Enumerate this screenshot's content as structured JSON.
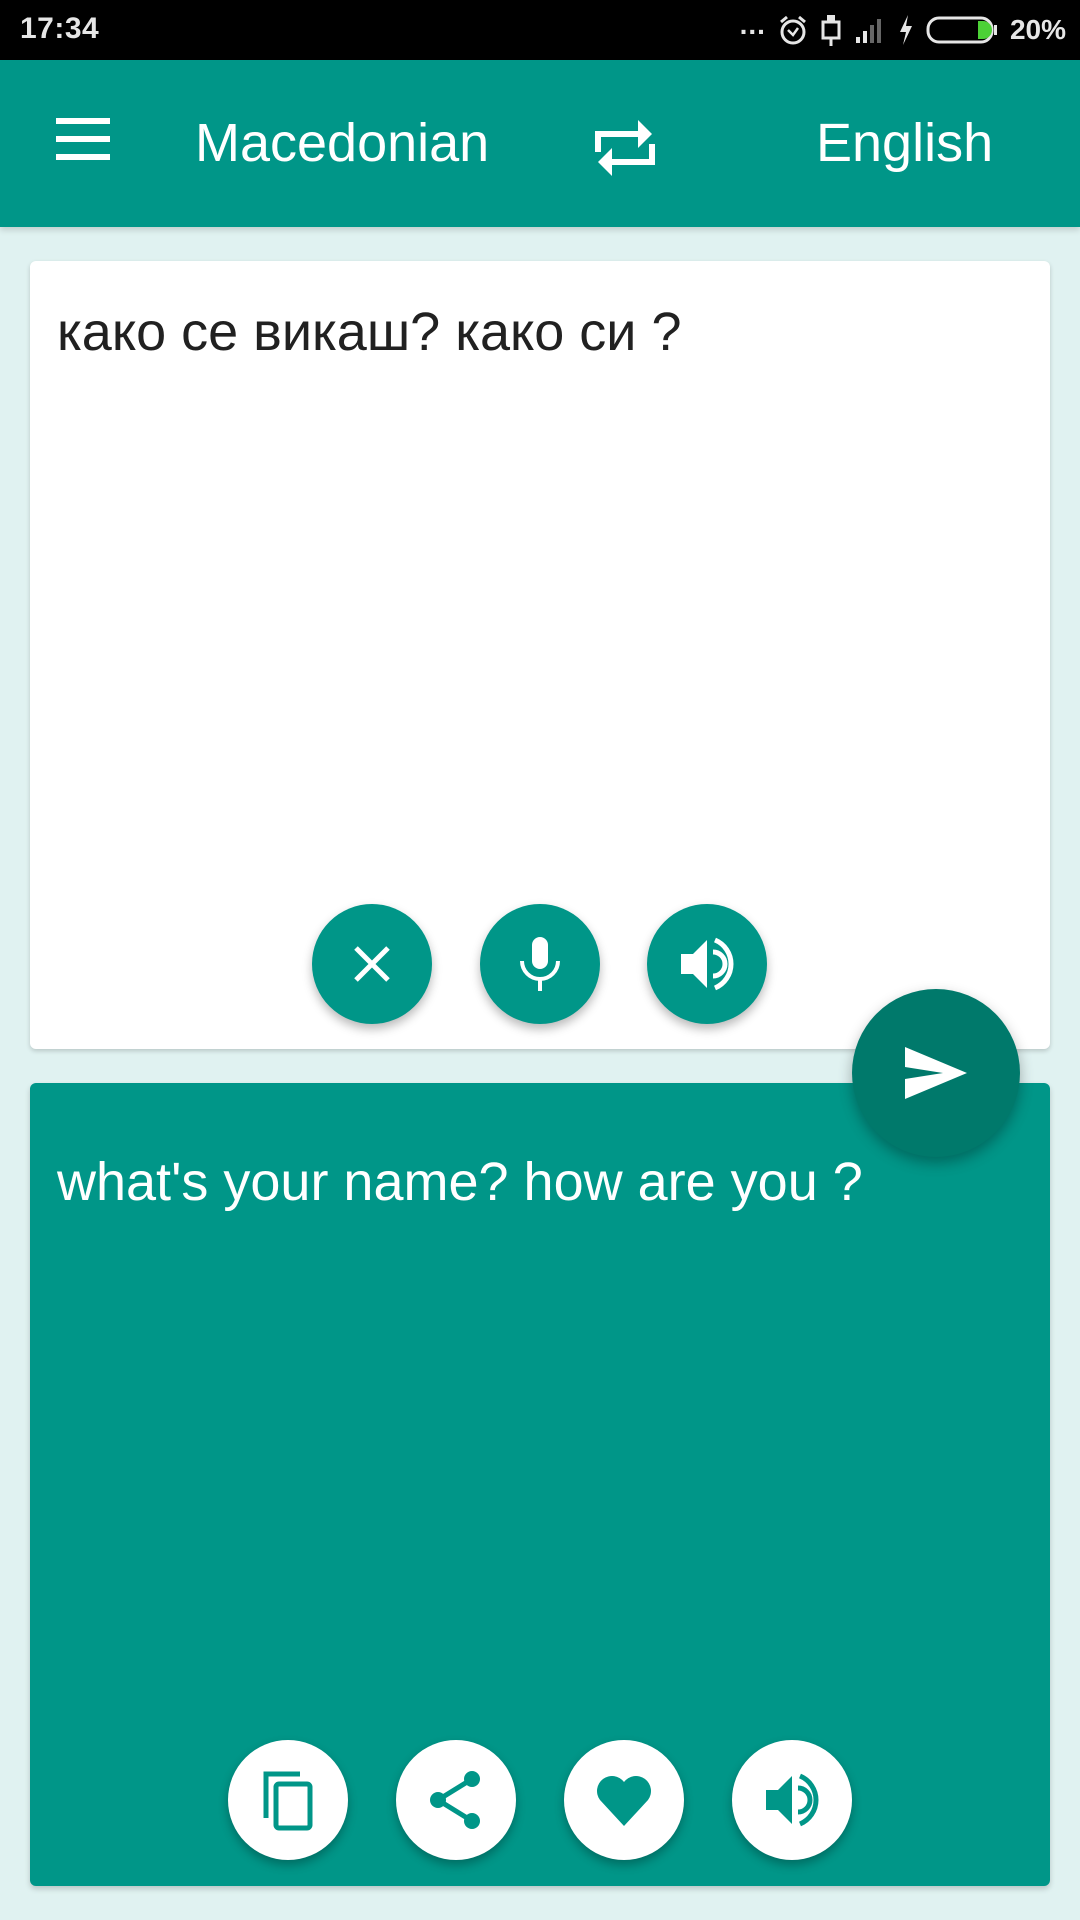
{
  "status_bar": {
    "time": "17:34",
    "more_indicator": "...",
    "icons": [
      "alarm-icon",
      "usb-icon",
      "signal-icon",
      "charging-icon",
      "battery-icon"
    ],
    "battery_percent": "20%",
    "battery_level": 0.2,
    "battery_color": "#4cd137"
  },
  "app_bar": {
    "menu_icon": "hamburger-menu-icon",
    "source_language": "Macedonian",
    "swap_icon": "swap-languages-icon",
    "target_language": "English",
    "color": "#009688"
  },
  "input_card": {
    "text": "како се викаш? како си ?",
    "buttons": [
      {
        "name": "clear",
        "icon": "close-icon"
      },
      {
        "name": "voice-input",
        "icon": "microphone-icon"
      },
      {
        "name": "speak-source",
        "icon": "speaker-icon"
      }
    ]
  },
  "translate_button": {
    "icon": "send-icon",
    "color": "#00796b"
  },
  "output_card": {
    "text": "what's your name? how are you ?",
    "buttons": [
      {
        "name": "copy",
        "icon": "copy-icon"
      },
      {
        "name": "share",
        "icon": "share-icon"
      },
      {
        "name": "favorite",
        "icon": "heart-icon"
      },
      {
        "name": "speak-translation",
        "icon": "speaker-icon"
      }
    ]
  },
  "colors": {
    "accent": "#009688",
    "accent_dark": "#00796b",
    "background": "#e0f2f1"
  }
}
